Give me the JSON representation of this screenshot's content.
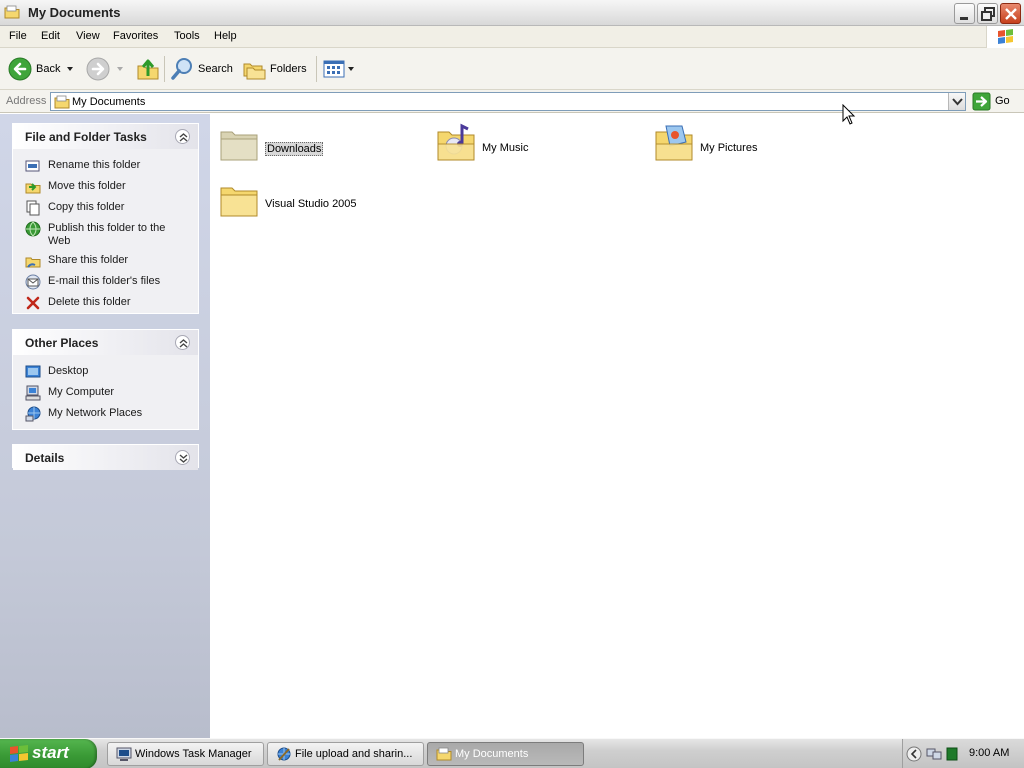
{
  "window": {
    "title": "My Documents",
    "icon": "folder-icon"
  },
  "menu": [
    "File",
    "Edit",
    "View",
    "Favorites",
    "Tools",
    "Help"
  ],
  "toolbar": {
    "back_label": "Back",
    "search_label": "Search",
    "folders_label": "Folders"
  },
  "address": {
    "label": "Address",
    "value": "My Documents",
    "go_label": "Go"
  },
  "sidebar": {
    "file_tasks": {
      "title": "File and Folder Tasks",
      "items": [
        {
          "label": "Rename this folder",
          "icon": "rename-icon"
        },
        {
          "label": "Move this folder",
          "icon": "move-icon"
        },
        {
          "label": "Copy this folder",
          "icon": "copy-icon"
        },
        {
          "label": "Publish this folder to the Web",
          "icon": "globe-icon"
        },
        {
          "label": "Share this folder",
          "icon": "share-icon"
        },
        {
          "label": "E-mail this folder's files",
          "icon": "email-icon"
        },
        {
          "label": "Delete this folder",
          "icon": "delete-icon"
        }
      ]
    },
    "other_places": {
      "title": "Other Places",
      "items": [
        {
          "label": "Desktop",
          "icon": "desktop-icon"
        },
        {
          "label": "My Computer",
          "icon": "computer-icon"
        },
        {
          "label": "My Network Places",
          "icon": "network-icon"
        }
      ]
    },
    "details": {
      "title": "Details"
    }
  },
  "content": {
    "items": [
      {
        "label": "Downloads",
        "icon": "folder-icon",
        "selected": true
      },
      {
        "label": "My Music",
        "icon": "music-folder-icon",
        "selected": false
      },
      {
        "label": "My Pictures",
        "icon": "pictures-folder-icon",
        "selected": false
      },
      {
        "label": "Visual Studio 2005",
        "icon": "folder-icon",
        "selected": false
      }
    ]
  },
  "taskbar": {
    "start_label": "start",
    "tasks": [
      {
        "label": "Windows Task Manager",
        "active": false
      },
      {
        "label": "File upload and sharin...",
        "active": false
      },
      {
        "label": "My Documents",
        "active": true
      }
    ],
    "clock": "9:00 AM"
  },
  "colors": {
    "start_green": "#3a9a36",
    "close_red": "#c6401c",
    "task_pane": "#c4c9d8",
    "folder_yellow": "#f5d76e"
  }
}
